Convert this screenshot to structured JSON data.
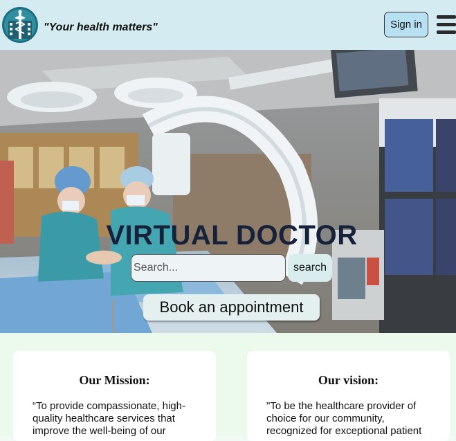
{
  "header": {
    "tagline": "\"Your health matters\"",
    "signin_label": "Sign in"
  },
  "hero": {
    "title": "VIRTUAL DOCTOR",
    "search_placeholder": "Search...",
    "search_label": "search",
    "book_label": "Book an appointment"
  },
  "cards": [
    {
      "title": "Our Mission:",
      "text": "“To provide compassionate, high-quality healthcare services that improve the well-being of our"
    },
    {
      "title": "Our vision:",
      "text": "\"To be the healthcare provider of choice for our community, recognized for exceptional patient"
    }
  ],
  "colors": {
    "header_bg": "#d4ecf1",
    "signin_bg": "#b7e0f2",
    "section_bg": "#ecfaee",
    "title_color": "#16213a"
  },
  "icons": [
    "hospital-logo-icon",
    "hamburger-menu-icon"
  ]
}
